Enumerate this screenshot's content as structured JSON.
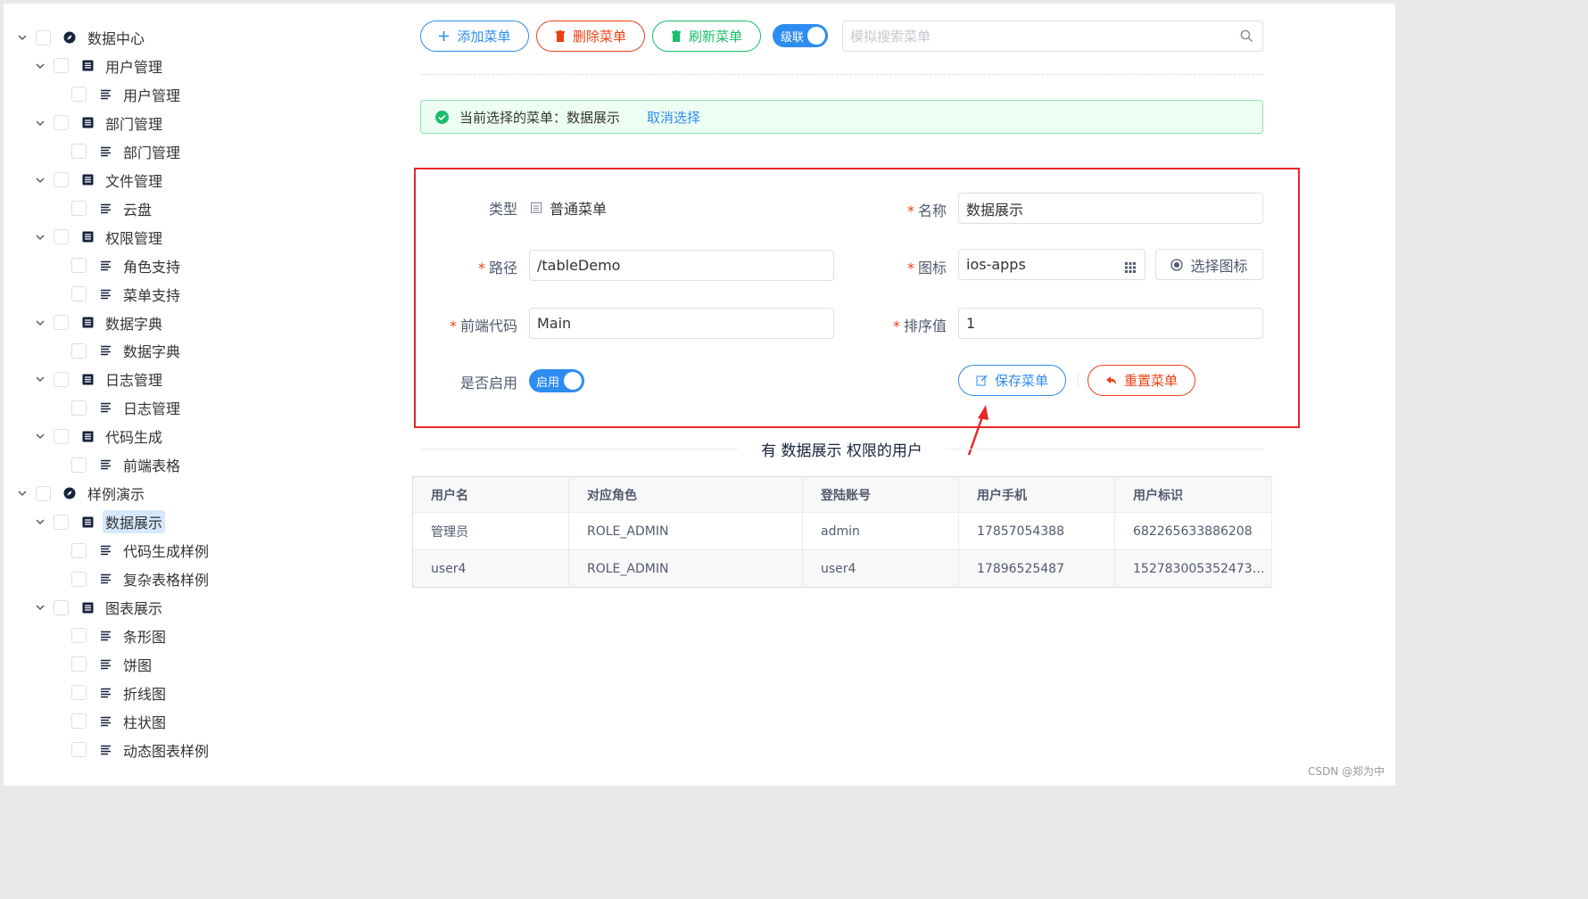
{
  "tree": [
    {
      "label": "数据中心",
      "level": 0,
      "kind": "root",
      "expanded": true
    },
    {
      "label": "用户管理",
      "level": 1,
      "kind": "group",
      "expanded": true
    },
    {
      "label": "用户管理",
      "level": 2,
      "kind": "leaf"
    },
    {
      "label": "部门管理",
      "level": 1,
      "kind": "group",
      "expanded": true
    },
    {
      "label": "部门管理",
      "level": 2,
      "kind": "leaf"
    },
    {
      "label": "文件管理",
      "level": 1,
      "kind": "group",
      "expanded": true
    },
    {
      "label": "云盘",
      "level": 2,
      "kind": "leaf"
    },
    {
      "label": "权限管理",
      "level": 1,
      "kind": "group",
      "expanded": true
    },
    {
      "label": "角色支持",
      "level": 2,
      "kind": "leaf"
    },
    {
      "label": "菜单支持",
      "level": 2,
      "kind": "leaf"
    },
    {
      "label": "数据字典",
      "level": 1,
      "kind": "group",
      "expanded": true
    },
    {
      "label": "数据字典",
      "level": 2,
      "kind": "leaf"
    },
    {
      "label": "日志管理",
      "level": 1,
      "kind": "group",
      "expanded": true
    },
    {
      "label": "日志管理",
      "level": 2,
      "kind": "leaf"
    },
    {
      "label": "代码生成",
      "level": 1,
      "kind": "group",
      "expanded": true
    },
    {
      "label": "前端表格",
      "level": 2,
      "kind": "leaf"
    },
    {
      "label": "样例演示",
      "level": 0,
      "kind": "root",
      "expanded": true
    },
    {
      "label": "数据展示",
      "level": 1,
      "kind": "group",
      "expanded": true,
      "selected": true
    },
    {
      "label": "代码生成样例",
      "level": 2,
      "kind": "leaf"
    },
    {
      "label": "复杂表格样例",
      "level": 2,
      "kind": "leaf"
    },
    {
      "label": "图表展示",
      "level": 1,
      "kind": "group",
      "expanded": true
    },
    {
      "label": "条形图",
      "level": 2,
      "kind": "leaf"
    },
    {
      "label": "饼图",
      "level": 2,
      "kind": "leaf"
    },
    {
      "label": "折线图",
      "level": 2,
      "kind": "leaf"
    },
    {
      "label": "柱状图",
      "level": 2,
      "kind": "leaf"
    },
    {
      "label": "动态图表样例",
      "level": 2,
      "kind": "leaf"
    }
  ],
  "toolbar": {
    "add_label": "添加菜单",
    "delete_label": "删除菜单",
    "refresh_label": "刷新菜单",
    "cascade_label": "级联",
    "cascade_on": true,
    "search_placeholder": "模拟搜索菜单",
    "search_value": ""
  },
  "alert": {
    "prefix": "当前选择的菜单：",
    "selected": "数据展示",
    "cancel": "取消选择"
  },
  "form": {
    "type_label": "类型",
    "type_value": "普通菜单",
    "name_label": "名称",
    "name_value": "数据展示",
    "path_label": "路径",
    "path_value": "/tableDemo",
    "icon_label": "图标",
    "icon_value": "ios-apps",
    "choose_icon_label": "选择图标",
    "frontend_label": "前端代码",
    "frontend_value": "Main",
    "sort_label": "排序值",
    "sort_value": "1",
    "enable_label": "是否启用",
    "enable_switch_label": "启用",
    "enable_on": true,
    "save_label": "保存菜单",
    "reset_label": "重置菜单"
  },
  "divider_title": "有 数据展示 权限的用户",
  "table": {
    "columns": [
      "用户名",
      "对应角色",
      "登陆账号",
      "用户手机",
      "用户标识"
    ],
    "rows": [
      [
        "管理员",
        "ROLE_ADMIN",
        "admin",
        "17857054388",
        "682265633886208"
      ],
      [
        "user4",
        "ROLE_ADMIN",
        "user4",
        "17896525487",
        "1527830053524738..."
      ]
    ]
  },
  "watermark": "CSDN @郑为中",
  "colors": {
    "primary": "#2d8cf0",
    "error": "#ed4014",
    "success": "#19be6b",
    "annotation": "#e8252c"
  }
}
